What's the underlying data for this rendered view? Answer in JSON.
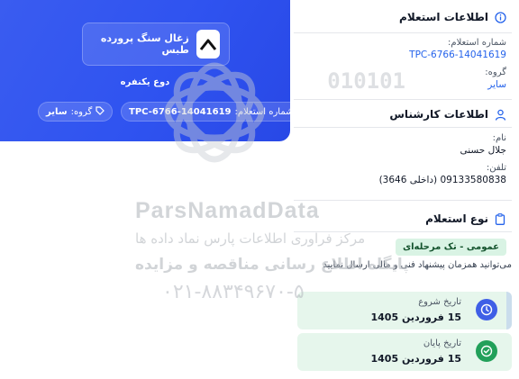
{
  "hero": {
    "title": "زغال سنگ پرورده طبس",
    "subtitle": "دوع یکنفره",
    "inquiry_number_label": "شماره استعلام:",
    "inquiry_number": "TPC-6766-14041619",
    "group_label": "گروه:",
    "group": "سایر"
  },
  "inquiry_info": {
    "heading": "اطلاعات استعلام",
    "number_label": "شماره استعلام:",
    "number": "TPC-6766-14041619",
    "group_label": "گروه:",
    "group": "سایر"
  },
  "expert_info": {
    "heading": "اطلاعات کارشناس",
    "name_label": "نام:",
    "name": "جلال حسنی",
    "phone_label": "تلفن:",
    "phone": "09133580838 (داخلی 3646)"
  },
  "inquiry_type": {
    "heading": "نوع استعلام",
    "tag": "عمومی - تک مرحله‌ای",
    "description": "می‌توانید همزمان پیشنهاد فنی و مالی ارسال نمایید"
  },
  "dates": {
    "start_label": "تاریخ شروع",
    "start_value": "15 فروردین 1405",
    "end_label": "تاریخ پایان",
    "end_value": "15 فروردین 1405"
  },
  "watermark": {
    "digits": "010101",
    "brand": "ParsNamadData",
    "line1": "مرکز فراوری اطلاعات پارس نماد داده ها",
    "line2": "پایگاه اطلاع رسانی مناقصه و مزایده",
    "phone": "۰۲۱-۸۸۳۴۹۶۷۰-۵"
  },
  "colors": {
    "hero_blue": "#2f53f0",
    "accent_blue": "#2563eb",
    "success_green": "#16a34a",
    "tag_green_bg": "#d9f3e4"
  }
}
